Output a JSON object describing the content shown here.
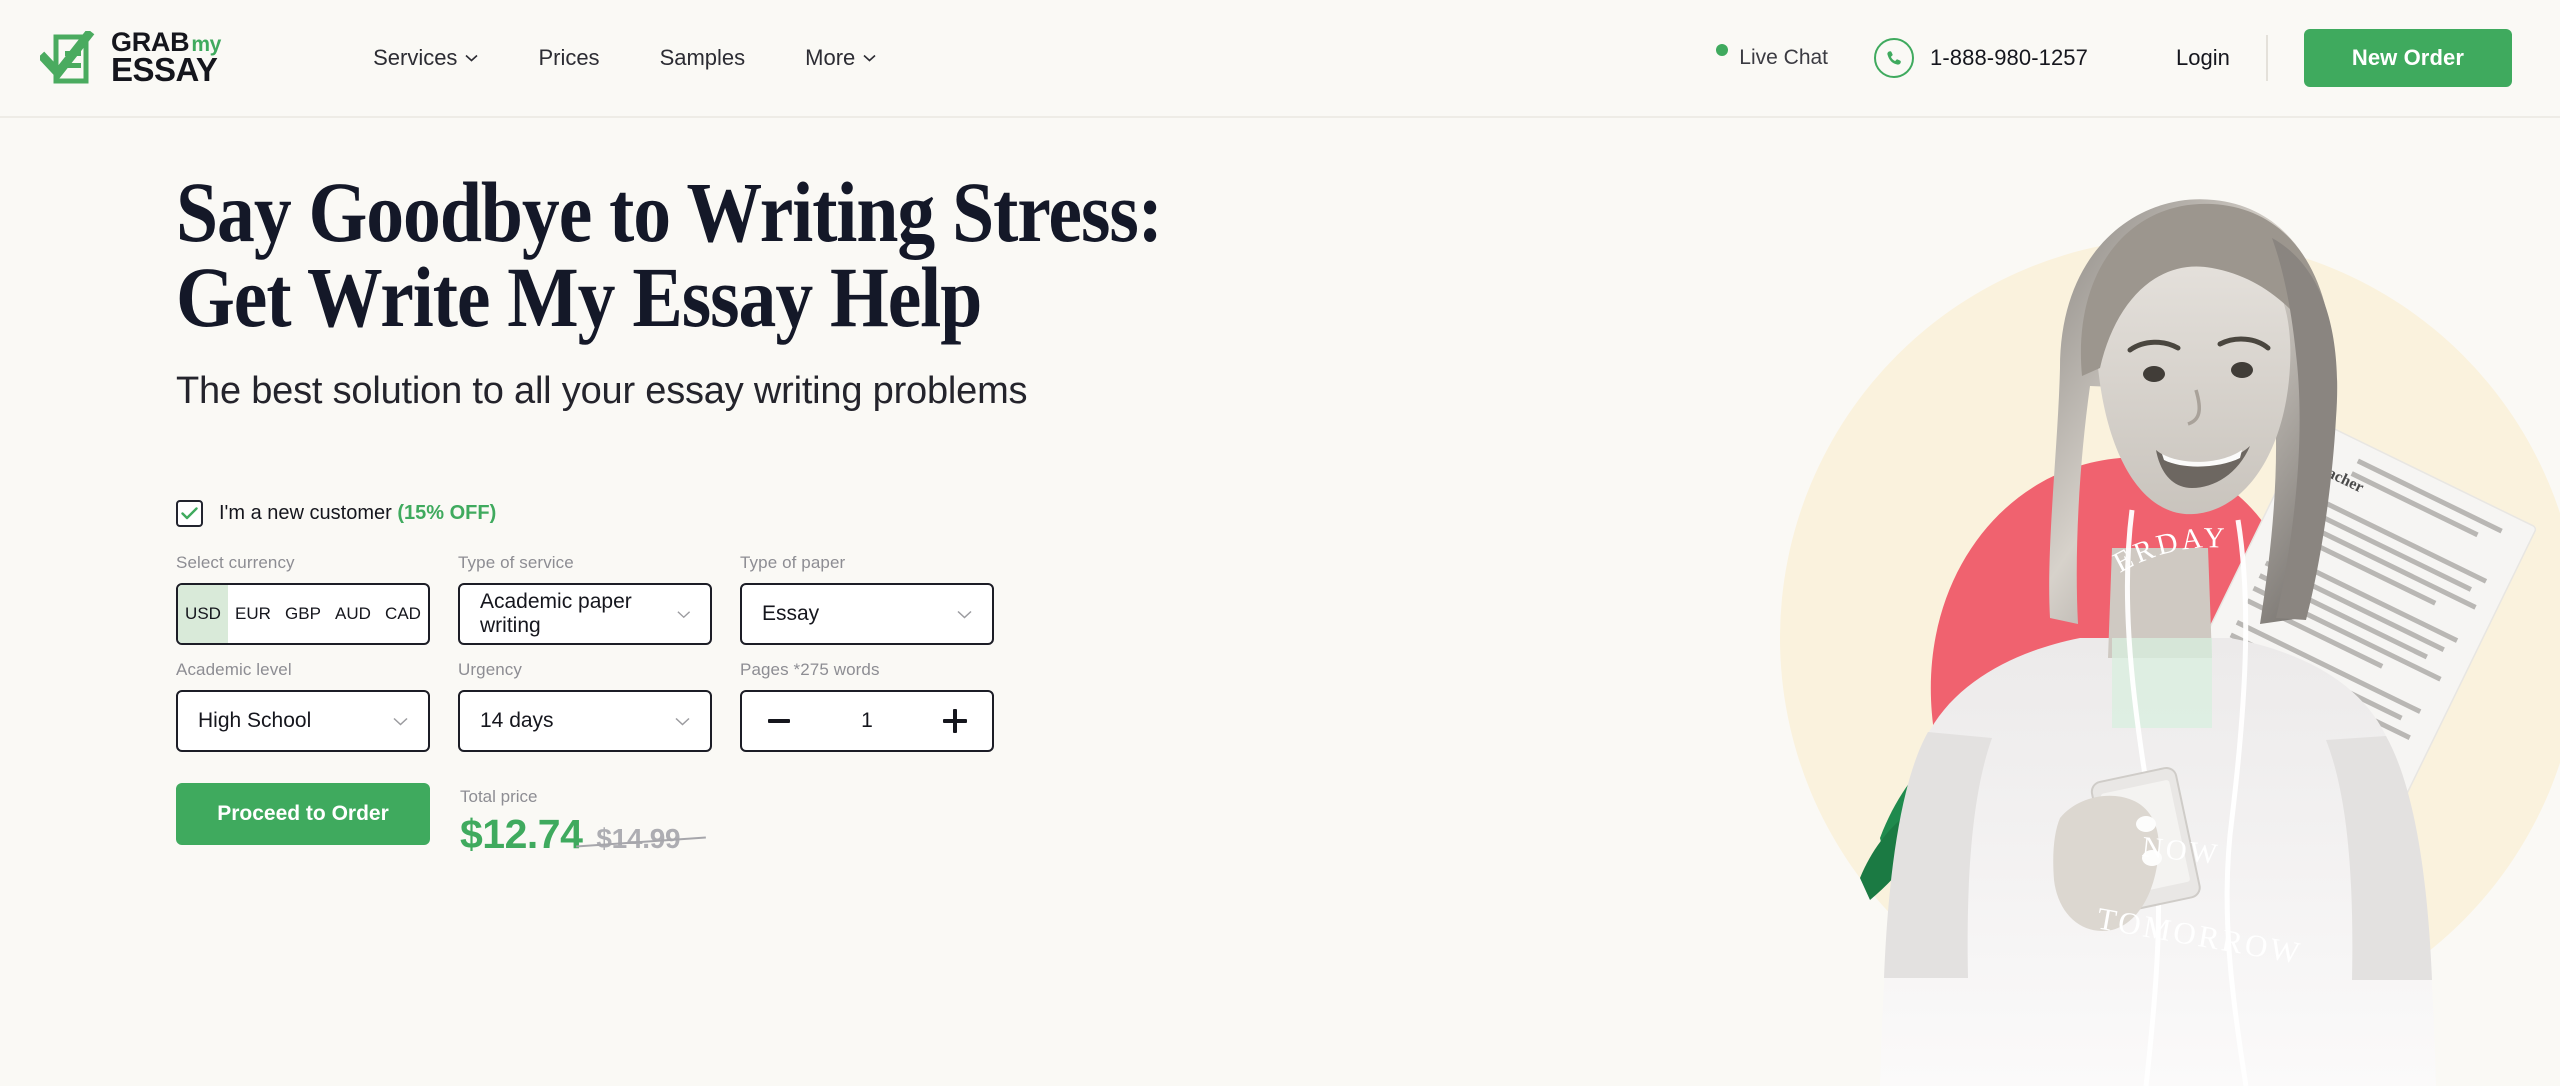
{
  "brand": {
    "name_part1": "GRAB",
    "name_my": "my",
    "name_part2": "ESSAY",
    "accent_color": "#3faa5e",
    "logo_icon": "document-check-icon"
  },
  "header": {
    "nav": [
      {
        "label": "Services",
        "has_dropdown": true
      },
      {
        "label": "Prices",
        "has_dropdown": false
      },
      {
        "label": "Samples",
        "has_dropdown": false
      },
      {
        "label": "More",
        "has_dropdown": true
      }
    ],
    "live_chat": {
      "label": "Live Chat",
      "status_color": "#3faa5e"
    },
    "phone": {
      "number": "1-888-980-1257",
      "icon": "phone-icon"
    },
    "login_label": "Login",
    "new_order_label": "New Order"
  },
  "hero": {
    "headline_line1": "Say Goodbye to Writing Stress:",
    "headline_line2": "Get Write My Essay Help",
    "subheadline": "The best solution to all your essay writing problems",
    "art": {
      "shirt_text_line1": "ERDAY",
      "shirt_text_line2": "NOW",
      "shirt_text_line3": "TOMORROW",
      "paper_label": "Teacher",
      "circle_cream": "#faf2dd",
      "shape_coral": "#f0626f",
      "leaf_green": "#1f8a4d"
    }
  },
  "calculator": {
    "new_customer": {
      "checked": true,
      "label": "I'm a new customer",
      "discount": "(15% OFF)"
    },
    "currency": {
      "label": "Select currency",
      "options": [
        "USD",
        "EUR",
        "GBP",
        "AUD",
        "CAD"
      ],
      "selected": "USD"
    },
    "service": {
      "label": "Type of service",
      "value": "Academic paper writing"
    },
    "paper": {
      "label": "Type of paper",
      "value": "Essay"
    },
    "level": {
      "label": "Academic level",
      "value": "High School"
    },
    "urgency": {
      "label": "Urgency",
      "value": "14 days"
    },
    "pages": {
      "label": "Pages *275 words",
      "value": "1",
      "minus": "−",
      "plus": "+"
    },
    "submit_label": "Proceed to Order",
    "price": {
      "label": "Total price",
      "current": "$12.74",
      "original": "$14.99",
      "current_color": "#3faa5e"
    }
  }
}
